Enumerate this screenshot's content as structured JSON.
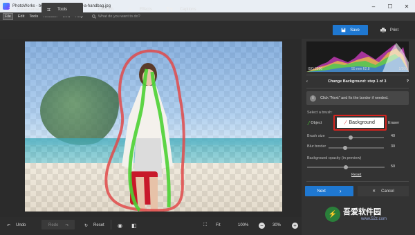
{
  "window": {
    "title": "PhotoWorks - beautiful-young-girl-with-a-handbag.jpg",
    "minimize": "–",
    "maximize": "☐",
    "close": "✕"
  },
  "menu": {
    "items": [
      "File",
      "Edit",
      "Tools",
      "Retouch",
      "View",
      "Help"
    ],
    "search_placeholder": "What do you want to do?"
  },
  "tabs": [
    {
      "label": "Enhancement",
      "icon": "sliders-icon"
    },
    {
      "label": "Tools",
      "icon": "crop-icon"
    },
    {
      "label": "Retouch",
      "icon": "brush-icon"
    },
    {
      "label": "Effects",
      "icon": "magic-wand-icon"
    },
    {
      "label": "Captions",
      "icon": "text-icon"
    }
  ],
  "save_label": "Save",
  "print_label": "Print",
  "histogram": {
    "iso": "ISO 2500",
    "lens": "55 mm f/2.8",
    "shutter": "1/200"
  },
  "step": {
    "title": "Change Background: step 1 of 3",
    "help": "?",
    "info_text": "Click \"Next\" and fix the border if needed."
  },
  "brush": {
    "select_label": "Select a brush:",
    "object": "Object",
    "background": "Background",
    "eraser": "Eraser"
  },
  "sliders": [
    {
      "label": "Brush size",
      "value": "40",
      "level": 0.4
    },
    {
      "label": "Blur border",
      "value": "30",
      "level": 0.3
    },
    {
      "label": "Background opacity (in preview)",
      "value": "50",
      "level": 0.5
    }
  ],
  "reset_link": "Reset",
  "next_label": "Next",
  "next_arrow": "›",
  "cancel_label": "Cancel",
  "cancel_icon": "✕",
  "bottom": {
    "undo": "Undo",
    "redo": "Redo",
    "reset": "Reset",
    "fit": "Fit",
    "zoom1": "100%",
    "zoom2": "30%"
  },
  "watermark": {
    "text": "吾爱软件园",
    "url": "www.52z.com"
  },
  "colors": {
    "accent": "#1f78d1",
    "highlight": "#d8231f",
    "object_stroke": "#4cd134",
    "background_stroke": "#e04a4a"
  }
}
